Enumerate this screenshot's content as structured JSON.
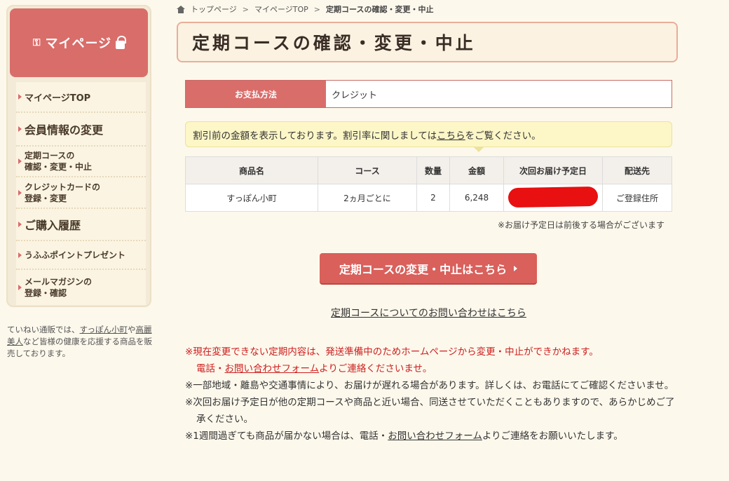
{
  "sidebar": {
    "header": "マイページ",
    "items": [
      {
        "line1": "マイページTOP",
        "line2": ""
      },
      {
        "line1": "会員情報の変更",
        "line2": ""
      },
      {
        "line1": "定期コースの",
        "line2": "確認・変更・中止"
      },
      {
        "line1": "クレジットカードの",
        "line2": "登録・変更"
      },
      {
        "line1": "ご購入履歴",
        "line2": ""
      },
      {
        "line1": "うふふポイントプレゼント",
        "line2": ""
      },
      {
        "line1": "メールマガジンの",
        "line2": "登録・確認"
      }
    ],
    "desc_pre": "ていねい通販では、",
    "desc_link1": "すっぽん小町",
    "desc_mid": "や",
    "desc_link2": "高麗美人",
    "desc_post": "など皆様の健康を応援する商品を販売しております。"
  },
  "breadcrumb": {
    "home": "トップページ",
    "sep": ">",
    "mypage": "マイページTOP",
    "current": "定期コースの確認・変更・中止"
  },
  "page_title": "定期コースの確認・変更・中止",
  "payment": {
    "label": "お支払方法",
    "value": "クレジット"
  },
  "notice": {
    "pre": "割引前の金額を表示しております。割引率に関しましては",
    "link": "こちら",
    "post": "をご覧ください。"
  },
  "table": {
    "headers": [
      "商品名",
      "コース",
      "数量",
      "金額",
      "次回お届け予定日",
      "配送先"
    ],
    "rows": [
      {
        "product": "すっぽん小町",
        "course": "2ヵ月ごとに",
        "qty": "2",
        "price": "6,248",
        "next_date": "",
        "address": "ご登録住所"
      }
    ]
  },
  "delivery_note": "※お届け予定日は前後する場合がございます",
  "main_button": "定期コースの変更・中止はこちら",
  "contact_link": "定期コースについてのお問い合わせはこちら",
  "notes": {
    "n1_a": "※現在変更できない定期内容は、発送準備中のためホームページから変更・中止ができかねます。",
    "n1_b_link1": "電話",
    "n1_b_sep": "・",
    "n1_b_link2": "お問い合わせフォーム",
    "n1_b_post": "よりご連絡くださいませ。",
    "n2": "※一部地域・離島や交通事情により、お届けが遅れる場合があります。詳しくは、お電話にてご確認くださいませ。",
    "n3": "※次回お届け予定日が他の定期コースや商品と近い場合、同送させていただくこともありますので、あらかじめご了承ください。",
    "n4_pre": "※1週間過ぎても商品が届かない場合は、電話・",
    "n4_link": "お問い合わせフォーム",
    "n4_post": "よりご連絡をお願いいたします。"
  },
  "colors": {
    "accent": "#d96d6a",
    "page_bg": "#fdf8ec",
    "notice_bg": "#fdf6c7",
    "warning": "#cc1f1f"
  }
}
